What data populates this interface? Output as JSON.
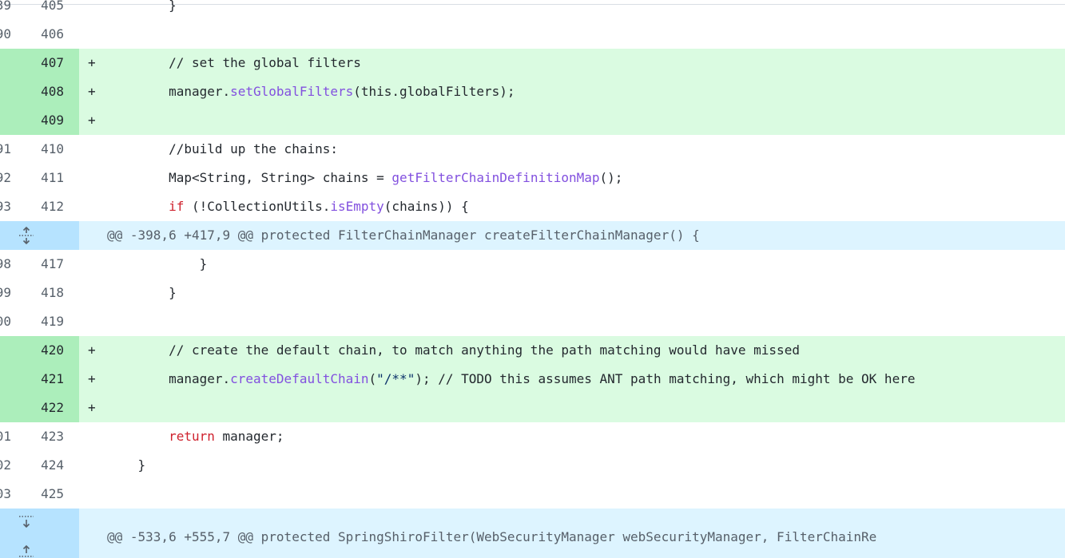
{
  "lines": [
    {
      "type": "ctx",
      "old": "39",
      "new": "405",
      "tokens": [
        {
          "t": "        }",
          "c": ""
        }
      ]
    },
    {
      "type": "ctx",
      "old": "90",
      "new": "406",
      "tokens": []
    },
    {
      "type": "add",
      "old": "",
      "new": "407",
      "tokens": [
        {
          "t": "        // set the global filters",
          "c": "cm-plain"
        }
      ]
    },
    {
      "type": "add",
      "old": "",
      "new": "408",
      "tokens": [
        {
          "t": "        manager.",
          "c": ""
        },
        {
          "t": "setGlobalFilters",
          "c": "fn"
        },
        {
          "t": "(this.globalFilters);",
          "c": ""
        }
      ]
    },
    {
      "type": "add",
      "old": "",
      "new": "409",
      "tokens": []
    },
    {
      "type": "ctx",
      "old": "91",
      "new": "410",
      "tokens": [
        {
          "t": "        //build up the chains:",
          "c": ""
        }
      ]
    },
    {
      "type": "ctx",
      "old": "92",
      "new": "411",
      "tokens": [
        {
          "t": "        Map<String, String> chains = ",
          "c": ""
        },
        {
          "t": "getFilterChainDefinitionMap",
          "c": "fn"
        },
        {
          "t": "();",
          "c": ""
        }
      ]
    },
    {
      "type": "ctx",
      "old": "93",
      "new": "412",
      "tokens": [
        {
          "t": "        ",
          "c": ""
        },
        {
          "t": "if",
          "c": "kw"
        },
        {
          "t": " (!CollectionUtils.",
          "c": ""
        },
        {
          "t": "isEmpty",
          "c": "fn"
        },
        {
          "t": "(chains)) {",
          "c": ""
        }
      ]
    },
    {
      "type": "hunk",
      "icon": "expand-both-icon",
      "text": "@@ -398,6 +417,9 @@ protected FilterChainManager createFilterChainManager() {"
    },
    {
      "type": "ctx",
      "old": "98",
      "new": "417",
      "tokens": [
        {
          "t": "            }",
          "c": ""
        }
      ]
    },
    {
      "type": "ctx",
      "old": "99",
      "new": "418",
      "tokens": [
        {
          "t": "        }",
          "c": ""
        }
      ]
    },
    {
      "type": "ctx",
      "old": "00",
      "new": "419",
      "tokens": []
    },
    {
      "type": "add",
      "old": "",
      "new": "420",
      "tokens": [
        {
          "t": "        // create the default chain, to match anything the path matching would have missed",
          "c": "cm-plain"
        }
      ]
    },
    {
      "type": "add",
      "old": "",
      "new": "421",
      "tokens": [
        {
          "t": "        manager.",
          "c": ""
        },
        {
          "t": "createDefaultChain",
          "c": "fn"
        },
        {
          "t": "(",
          "c": ""
        },
        {
          "t": "\"/**\"",
          "c": "str"
        },
        {
          "t": "); // TODO this assumes ANT path matching, which might be OK here",
          "c": ""
        }
      ]
    },
    {
      "type": "add",
      "old": "",
      "new": "422",
      "tokens": []
    },
    {
      "type": "ctx",
      "old": "01",
      "new": "423",
      "tokens": [
        {
          "t": "        ",
          "c": ""
        },
        {
          "t": "return",
          "c": "kw"
        },
        {
          "t": " manager;",
          "c": ""
        }
      ]
    },
    {
      "type": "ctx",
      "old": "02",
      "new": "424",
      "tokens": [
        {
          "t": "    }",
          "c": ""
        }
      ]
    },
    {
      "type": "ctx",
      "old": "03",
      "new": "425",
      "tokens": []
    },
    {
      "type": "hunk-tall",
      "icon": "expand-down-up-icon",
      "text": "@@ -533,6 +555,7 @@ protected SpringShiroFilter(WebSecurityManager webSecurityManager, FilterChainRe"
    }
  ]
}
